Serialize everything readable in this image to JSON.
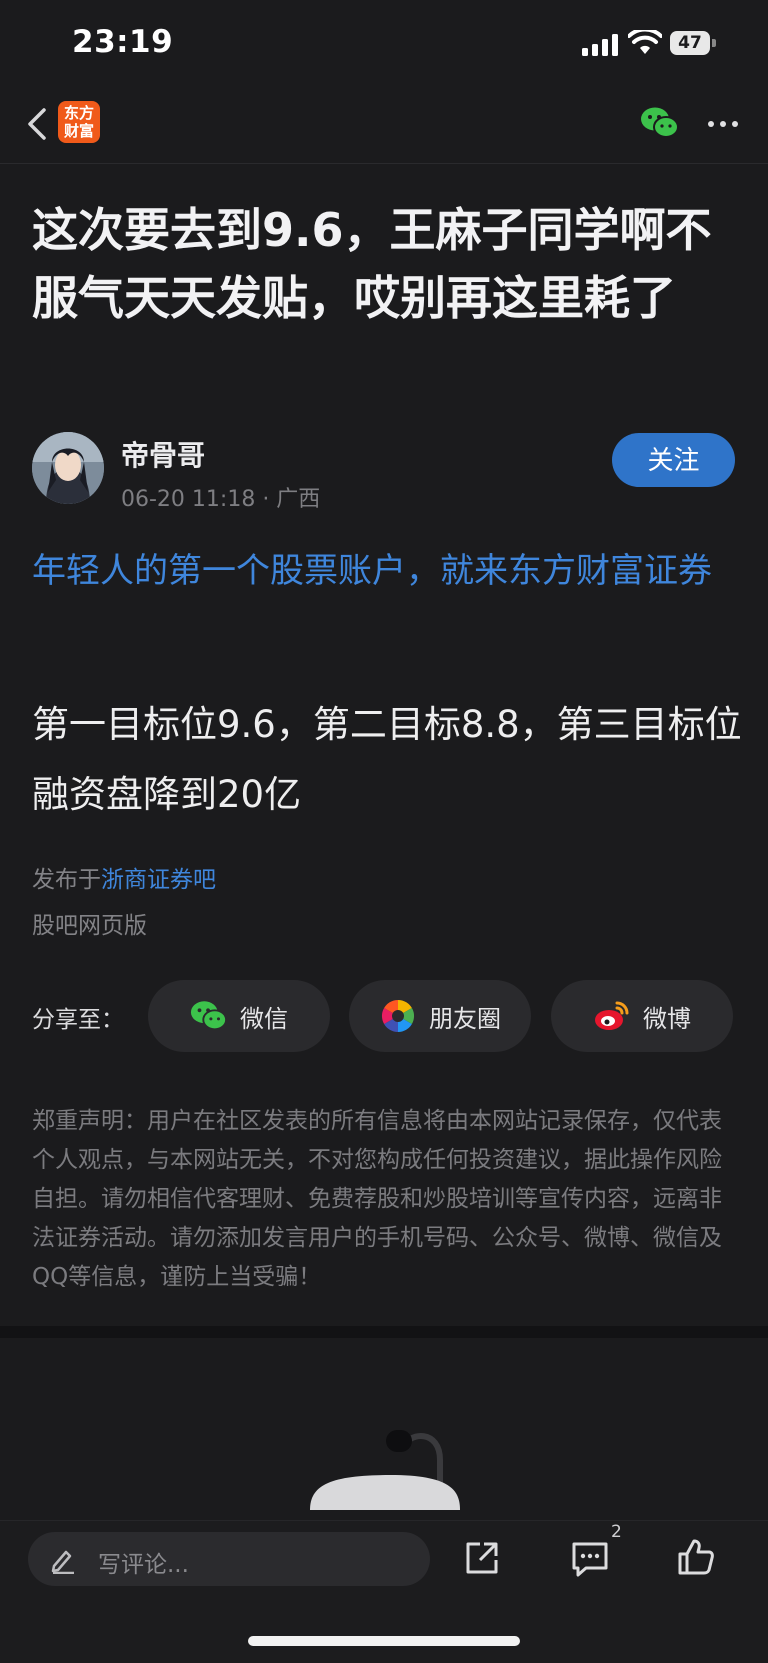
{
  "status_bar": {
    "time": "23:19",
    "battery": "47"
  },
  "nav": {
    "logo_line1": "东方",
    "logo_line2": "财富"
  },
  "post": {
    "title": "这次要去到9.6，王麻子同学啊不服气天天发贴，哎别再这里耗了",
    "author": {
      "name": "帝骨哥",
      "meta": "06-20 11:18 · 广西",
      "follow_label": "关注"
    },
    "ad_link": "年轻人的第一个股票账户，就来东方财富证券",
    "body": "第一目标位9.6，第二目标8.8，第三目标位融资盘降到20亿",
    "published_prefix": "发布于",
    "published_bar": "浙商证券吧",
    "web_version": "股吧网页版"
  },
  "share": {
    "label": "分享至：",
    "options": [
      {
        "label": "微信",
        "icon": "wechat-icon"
      },
      {
        "label": "朋友圈",
        "icon": "moments-icon"
      },
      {
        "label": "微博",
        "icon": "weibo-icon"
      }
    ]
  },
  "disclaimer": "郑重声明：用户在社区发表的所有信息将由本网站记录保存，仅代表个人观点，与本网站无关，不对您构成任何投资建议，据此操作风险自担。请勿相信代客理财、免费荐股和炒股培训等宣传内容，远离非法证券活动。请勿添加发言用户的手机号码、公众号、微博、微信及QQ等信息，谨防上当受骗！",
  "bottom_bar": {
    "comment_placeholder": "写评论...",
    "comment_count": "2"
  },
  "colors": {
    "accent": "#2f74c9",
    "link": "#3f86dc",
    "brand": "#f05a1a",
    "background": "#1b1b1d"
  }
}
